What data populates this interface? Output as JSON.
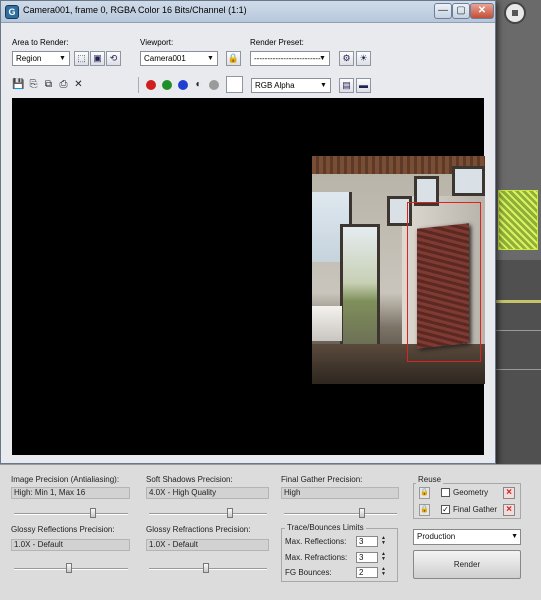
{
  "window": {
    "title": "Camera001, frame 0, RGBA Color 16 Bits/Channel (1:1)",
    "controls": {
      "minimize": "—",
      "maximize": "▢",
      "close": "✕"
    }
  },
  "settings": {
    "area_to_render_label": "Area to Render:",
    "area_to_render_value": "Region",
    "viewport_label": "Viewport:",
    "viewport_value": "Camera001",
    "render_preset_label": "Render Preset:",
    "render_preset_value": "-------------------------"
  },
  "toolbar": {
    "channel_display_value": "RGB Alpha",
    "icons": [
      "save-icon",
      "copy-icon",
      "clone-icon",
      "print-icon",
      "clear-icon"
    ],
    "channel_colors": {
      "red": "#d11f1f",
      "green": "#1f8f2a",
      "blue": "#1f3fd1"
    }
  },
  "panel": {
    "image_precision_label": "Image Precision (Antialiasing):",
    "image_precision_value": "High: Min 1, Max 16",
    "image_precision_level": 0.7,
    "soft_shadows_label": "Soft Shadows Precision:",
    "soft_shadows_value": "4.0X - High Quality",
    "soft_shadows_level": 0.7,
    "final_gather_label": "Final Gather Precision:",
    "final_gather_value": "High",
    "final_gather_level": 0.7,
    "glossy_reflections_label": "Glossy Reflections Precision:",
    "glossy_reflections_value": "1.0X - Default",
    "glossy_reflections_level": 0.48,
    "glossy_refractions_label": "Glossy Refractions Precision:",
    "glossy_refractions_value": "1.0X - Default",
    "glossy_refractions_level": 0.48,
    "trace_title": "Trace/Bounces Limits",
    "max_reflections_label": "Max. Reflections:",
    "max_reflections_value": "3",
    "max_refractions_label": "Max. Refractions:",
    "max_refractions_value": "3",
    "fg_bounces_label": "FG Bounces:",
    "fg_bounces_value": "2",
    "reuse_title": "Reuse",
    "geometry_label": "Geometry",
    "geometry_checked": false,
    "final_gather_reuse_label": "Final Gather",
    "final_gather_reuse_checked": true,
    "preset_value": "Production",
    "render_label": "Render"
  }
}
